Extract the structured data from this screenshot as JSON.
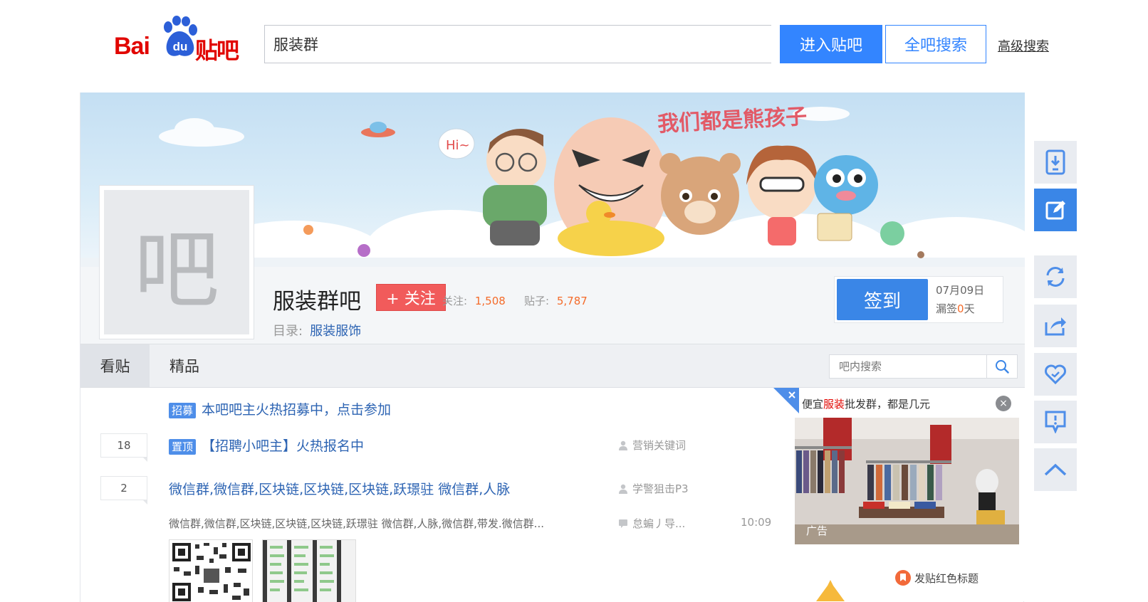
{
  "header": {
    "logo": {
      "bai": "Bai",
      "du": "du",
      "tieba": "贴吧"
    },
    "search_value": "服装群",
    "enter_bar_label": "进入贴吧",
    "search_all_label": "全吧搜索",
    "advanced_search_label": "高级搜索"
  },
  "banner": {
    "slogan": "我们都是熊孩子",
    "hi": "Hi~"
  },
  "forum": {
    "avatar_char": "吧",
    "name": "服装群吧",
    "follow_label": "+ 关注",
    "followers_label": "关注:",
    "followers": "1,508",
    "posts_label": "贴子:",
    "posts": "5,787",
    "catalog_label": "目录:",
    "catalog_value": "服装服饰"
  },
  "sign": {
    "button_label": "签到",
    "date": "07月09日",
    "missed_prefix": "漏签",
    "missed_days": "0",
    "missed_suffix": "天"
  },
  "tabs": [
    {
      "label": "看贴"
    },
    {
      "label": "精品"
    }
  ],
  "inbar_search": {
    "placeholder": "吧内搜索"
  },
  "threads": [
    {
      "tag": "招募",
      "title": "本吧吧主火热招募中，点击参加"
    },
    {
      "replies": "18",
      "tag": "置顶",
      "title": "【招聘小吧主】火热报名中",
      "author": "营销关键词"
    },
    {
      "replies": "2",
      "title": "微信群,微信群,区块链,区块链,区块链,跃璟驻 微信群,人脉",
      "author": "学警狙击P3",
      "abstract": "微信群,微信群,区块链,区块链,区块链,跃璟驻 微信群,人脉,微信群,带发.微信群...",
      "last_reply": "怠蝙丿导...",
      "time": "10:09"
    }
  ],
  "ad": {
    "title_pre": "便宜",
    "title_highlight": "服装",
    "title_post": "批发群，都是几元",
    "close": "×",
    "label": "广告",
    "promo": "发贴红色标题"
  },
  "colors": {
    "brand_red": "#e10601",
    "primary_blue": "#3385ff",
    "link_blue": "#2d64b3",
    "stat_orange": "#f46b2a"
  },
  "float_bar": [
    {
      "icon": "download-icon"
    },
    {
      "icon": "edit-icon"
    },
    {
      "icon": "refresh-icon"
    },
    {
      "icon": "share-icon"
    },
    {
      "icon": "favorite-icon"
    },
    {
      "icon": "report-icon"
    },
    {
      "icon": "back-to-top-icon"
    }
  ]
}
